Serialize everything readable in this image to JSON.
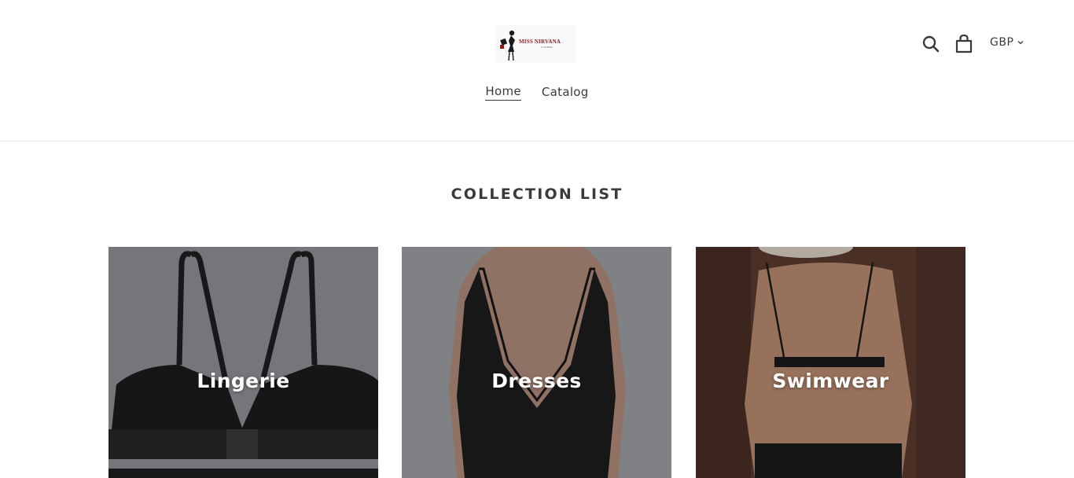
{
  "header": {
    "logo": {
      "name": "MISS NIRVANA",
      "tagline": "CLOTHING"
    },
    "nav": [
      {
        "label": "Home",
        "active": true
      },
      {
        "label": "Catalog",
        "active": false
      }
    ],
    "icons": {
      "search": "search-icon",
      "cart": "cart-icon"
    },
    "currency": "GBP"
  },
  "main": {
    "section_title": "COLLECTION LIST",
    "collections": [
      {
        "label": "Lingerie"
      },
      {
        "label": "Dresses"
      },
      {
        "label": "Swimwear"
      }
    ]
  },
  "colors": {
    "text": "#3a3a3a",
    "logo_accent": "#8b1a1a",
    "divider": "#e8e8e8"
  }
}
